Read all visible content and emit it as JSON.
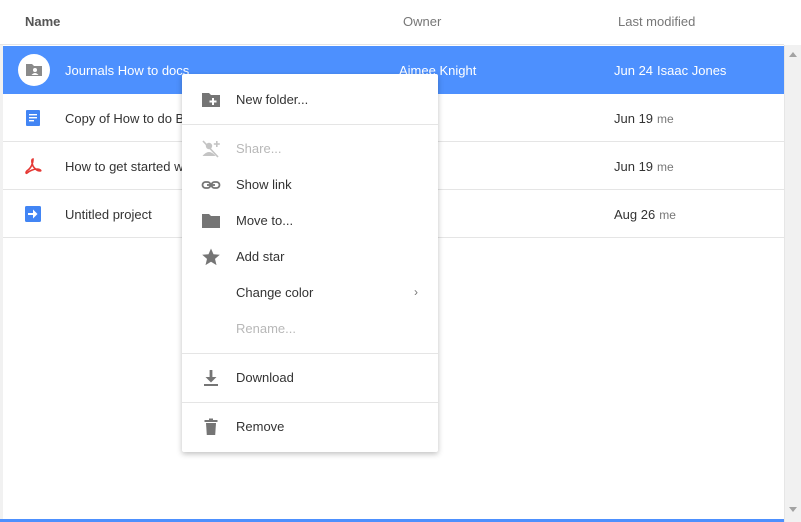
{
  "header": {
    "name": "Name",
    "owner": "Owner",
    "last_modified": "Last modified"
  },
  "rows": [
    {
      "name": "Journals How to docs",
      "owner": "Aimee Knight",
      "date": "Jun 24",
      "who": "Isaac Jones",
      "icon": "shared-folder-icon",
      "selected": true
    },
    {
      "name": "Copy of How to do Bl",
      "owner": "",
      "date": "Jun 19",
      "who": "me",
      "icon": "doc-icon"
    },
    {
      "name": "How to get started w",
      "owner": "",
      "date": "Jun 19",
      "who": "me",
      "icon": "pdf-icon"
    },
    {
      "name": "Untitled project",
      "owner": "",
      "date": "Aug 26",
      "who": "me",
      "icon": "script-project-icon"
    }
  ],
  "menu": {
    "items": [
      {
        "label": "New folder...",
        "icon": "new-folder-icon",
        "disabled": false
      },
      {
        "label": "Share...",
        "icon": "share-person-icon",
        "disabled": true
      },
      {
        "label": "Show link",
        "icon": "link-icon",
        "disabled": false
      },
      {
        "label": "Move to...",
        "icon": "folder-icon",
        "disabled": false
      },
      {
        "label": "Add star",
        "icon": "star-icon",
        "disabled": false
      },
      {
        "label": "Change color",
        "icon": "",
        "disabled": false,
        "submenu": true
      },
      {
        "label": "Rename...",
        "icon": "",
        "disabled": true
      },
      {
        "label": "Download",
        "icon": "download-icon",
        "disabled": false
      },
      {
        "label": "Remove",
        "icon": "trash-icon",
        "disabled": false
      }
    ],
    "submenu_glyph": "›"
  },
  "colors": {
    "selection": "#4d90fe",
    "doc_blue": "#4285f4",
    "pdf_red": "#e53935",
    "icon_gray": "#757575"
  }
}
